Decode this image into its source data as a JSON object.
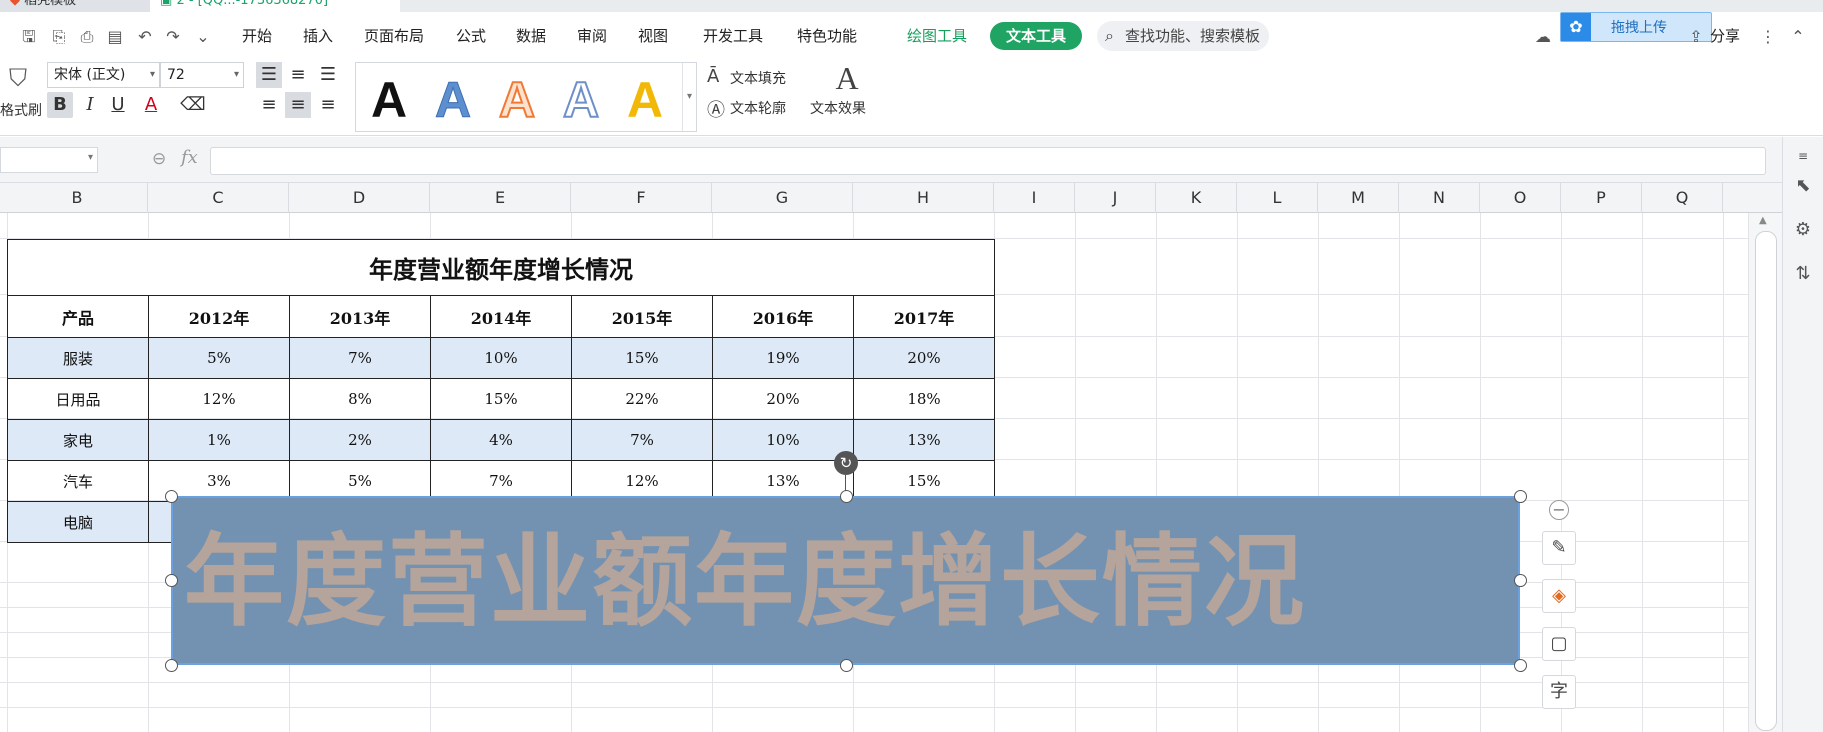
{
  "titlebar": {
    "tabs": [
      "稻壳模板",
      "2 - [QQ...-1736368270]"
    ]
  },
  "menubar": {
    "items": [
      "开始",
      "插入",
      "页面布局",
      "公式",
      "数据",
      "审阅",
      "视图",
      "开发工具",
      "特色功能"
    ],
    "context_tabs": [
      "绘图工具",
      "文本工具"
    ],
    "search_placeholder": "查找功能、搜索模板",
    "share_label": "分享",
    "upload_label": "拖拽上传"
  },
  "ribbon": {
    "format_painter_label": "格式刷",
    "font_name": "宋体 (正文)",
    "font_size": "72",
    "bold": "B",
    "italic": "I",
    "underline": "U",
    "font_color_letter": "A",
    "style_letter": "A",
    "text_fill_label": "文本填充",
    "text_outline_label": "文本轮廓",
    "text_effect_label": "文本效果",
    "style_colors": [
      "#111111",
      "#5b8fcf",
      "#f07a35",
      "#6f8fc9",
      "#f2b807"
    ]
  },
  "formula": {
    "fx_label": "fx",
    "zoom_icon": "search-icon"
  },
  "columns": [
    "B",
    "C",
    "D",
    "E",
    "F",
    "G",
    "H",
    "I",
    "J",
    "K",
    "L",
    "M",
    "N",
    "O",
    "P",
    "Q"
  ],
  "table": {
    "title": "年度营业额年度增长情况",
    "headers": [
      "产品",
      "2012年",
      "2013年",
      "2014年",
      "2015年",
      "2016年",
      "2017年"
    ],
    "rows": [
      {
        "product": "服装",
        "values": [
          "5%",
          "7%",
          "10%",
          "15%",
          "19%",
          "20%"
        ]
      },
      {
        "product": "日用品",
        "values": [
          "12%",
          "8%",
          "15%",
          "22%",
          "20%",
          "18%"
        ]
      },
      {
        "product": "家电",
        "values": [
          "1%",
          "2%",
          "4%",
          "7%",
          "10%",
          "13%"
        ]
      },
      {
        "product": "汽车",
        "values": [
          "3%",
          "5%",
          "7%",
          "12%",
          "13%",
          "15%"
        ]
      },
      {
        "product": "电脑",
        "values": [
          "",
          "",
          "",
          "",
          "",
          ""
        ]
      }
    ]
  },
  "textbox": {
    "text": "年度营业额年度增长情况",
    "fill_color": "#7392b1",
    "text_color": "#b5a49b"
  },
  "float_toolbar": {
    "text_icon_label": "字"
  }
}
